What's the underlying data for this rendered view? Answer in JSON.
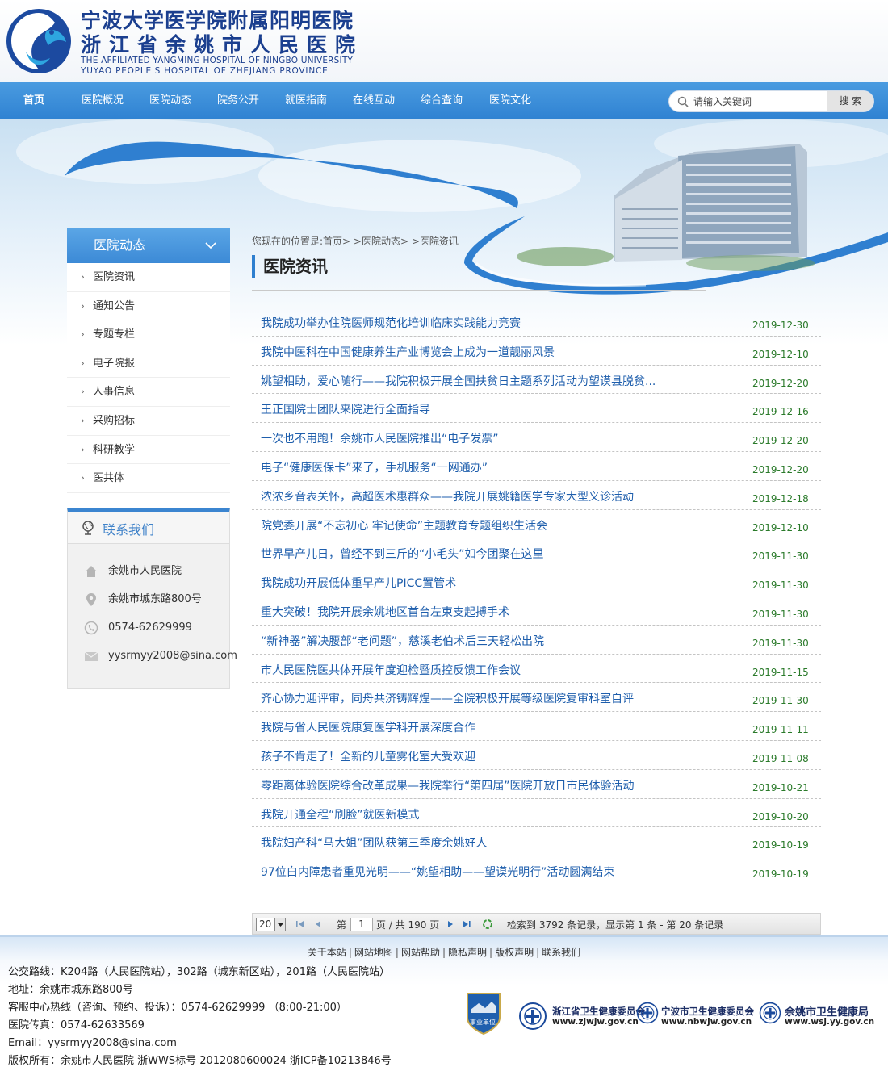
{
  "header": {
    "title_cn_1": "宁波大学医学院附属阳明医院",
    "title_cn_2": "浙江省余姚市人民医院",
    "title_en_1": "THE AFFILIATED YANGMING HOSPITAL OF NINGBO UNIVERSITY",
    "title_en_2": "YUYAO PEOPLE'S HOSPITAL OF ZHEJIANG  PROVINCE"
  },
  "nav": {
    "items": [
      "首页",
      "医院概况",
      "医院动态",
      "院务公开",
      "就医指南",
      "在线互动",
      "综合查询",
      "医院文化"
    ],
    "search_placeholder": "请输入关键词",
    "search_button": "搜 索"
  },
  "sidebar": {
    "title": "医院动态",
    "items": [
      "医院资讯",
      "通知公告",
      "专题专栏",
      "电子院报",
      "人事信息",
      "采购招标",
      "科研教学",
      "医共体"
    ]
  },
  "contact": {
    "title": "联系我们",
    "name": "余姚市人民医院",
    "address": "余姚市城东路800号",
    "phone": "0574-62629999",
    "email": "yysrmyy2008@sina.com"
  },
  "main": {
    "breadcrumb": "您现在的位置是:首页> >医院动态> >医院资讯",
    "title": "医院资讯",
    "news": [
      {
        "title": "我院成功举办住院医师规范化培训临床实践能力竞赛",
        "date": "2019-12-30"
      },
      {
        "title": "我院中医科在中国健康养生产业博览会上成为一道靓丽风景",
        "date": "2019-12-10"
      },
      {
        "title": "姚望相助，爱心随行——我院积极开展全国扶贫日主题系列活动为望谟县脱贫...",
        "date": "2019-12-20"
      },
      {
        "title": "王正国院士团队来院进行全面指导",
        "date": "2019-12-16"
      },
      {
        "title": "一次也不用跑！余姚市人民医院推出“电子发票”",
        "date": "2019-12-20"
      },
      {
        "title": "电子“健康医保卡”来了，手机服务“一网通办”",
        "date": "2019-12-20"
      },
      {
        "title": "浓浓乡音表关怀，高超医术惠群众——我院开展姚籍医学专家大型义诊活动",
        "date": "2019-12-18"
      },
      {
        "title": "院党委开展“不忘初心 牢记使命”主题教育专题组织生活会",
        "date": "2019-12-10"
      },
      {
        "title": "世界早产儿日，曾经不到三斤的“小毛头”如今团聚在这里",
        "date": "2019-11-30"
      },
      {
        "title": "我院成功开展低体重早产儿PICC置管术",
        "date": "2019-11-30"
      },
      {
        "title": "重大突破！我院开展余姚地区首台左束支起搏手术",
        "date": "2019-11-30"
      },
      {
        "title": "“新神器”解决腰部“老问题”，慈溪老伯术后三天轻松出院",
        "date": "2019-11-30"
      },
      {
        "title": "市人民医院医共体开展年度迎检暨质控反馈工作会议",
        "date": "2019-11-15"
      },
      {
        "title": "齐心协力迎评审，同舟共济铸辉煌——全院积极开展等级医院复审科室自评",
        "date": "2019-11-30"
      },
      {
        "title": "我院与省人民医院康复医学科开展深度合作",
        "date": "2019-11-11"
      },
      {
        "title": "孩子不肯走了！全新的儿童雾化室大受欢迎",
        "date": "2019-11-08"
      },
      {
        "title": "零距离体验医院综合改革成果—我院举行“第四届”医院开放日市民体验活动",
        "date": "2019-10-21"
      },
      {
        "title": "我院开通全程“刷脸”就医新模式",
        "date": "2019-10-20"
      },
      {
        "title": "我院妇产科“马大姐”团队获第三季度余姚好人",
        "date": "2019-10-19"
      },
      {
        "title": "97位白内障患者重见光明——“姚望相助——望谟光明行”活动圆满结束",
        "date": "2019-10-19"
      }
    ]
  },
  "pager": {
    "page_size": "20",
    "page_label_pre": "第",
    "current_page": "1",
    "page_label_post": "页 / 共 190 页",
    "summary": "检索到 3792 条记录，显示第 1 条 - 第 20 条记录"
  },
  "footer": {
    "links": [
      "关于本站",
      "网站地图",
      "网站帮助",
      "隐私声明",
      "版权声明",
      "联系我们"
    ],
    "lines": [
      "公交路线：K204路（人民医院站），302路（城东新区站），201路（人民医院站）",
      "地址：余姚市城东路800号",
      "客服中心热线（咨询、预约、投诉）：0574-62629999  （8:00-21:00）",
      "医院传真：0574-62633569",
      "Email：yysrmyy2008@sina.com",
      "版权所有：余姚市人民医院 浙WWS标号 2012080600024 浙ICP备10213846号"
    ],
    "badge_text": "事业单位",
    "orgs": [
      {
        "name": "浙江省卫生健康委员会",
        "url": "www.zjwjw.gov.cn"
      },
      {
        "name": "宁波市卫生健康委员会",
        "url": "www.nbwjw.gov.cn"
      },
      {
        "name": "余姚市卫生健康局",
        "url": "www.wsj.yy.gov.cn"
      }
    ]
  },
  "colors": {
    "nav_blue": "#3a8cd8",
    "link_blue": "#1e5eac",
    "date_green": "#2a7a2a",
    "title_navy": "#1b3f8f"
  }
}
